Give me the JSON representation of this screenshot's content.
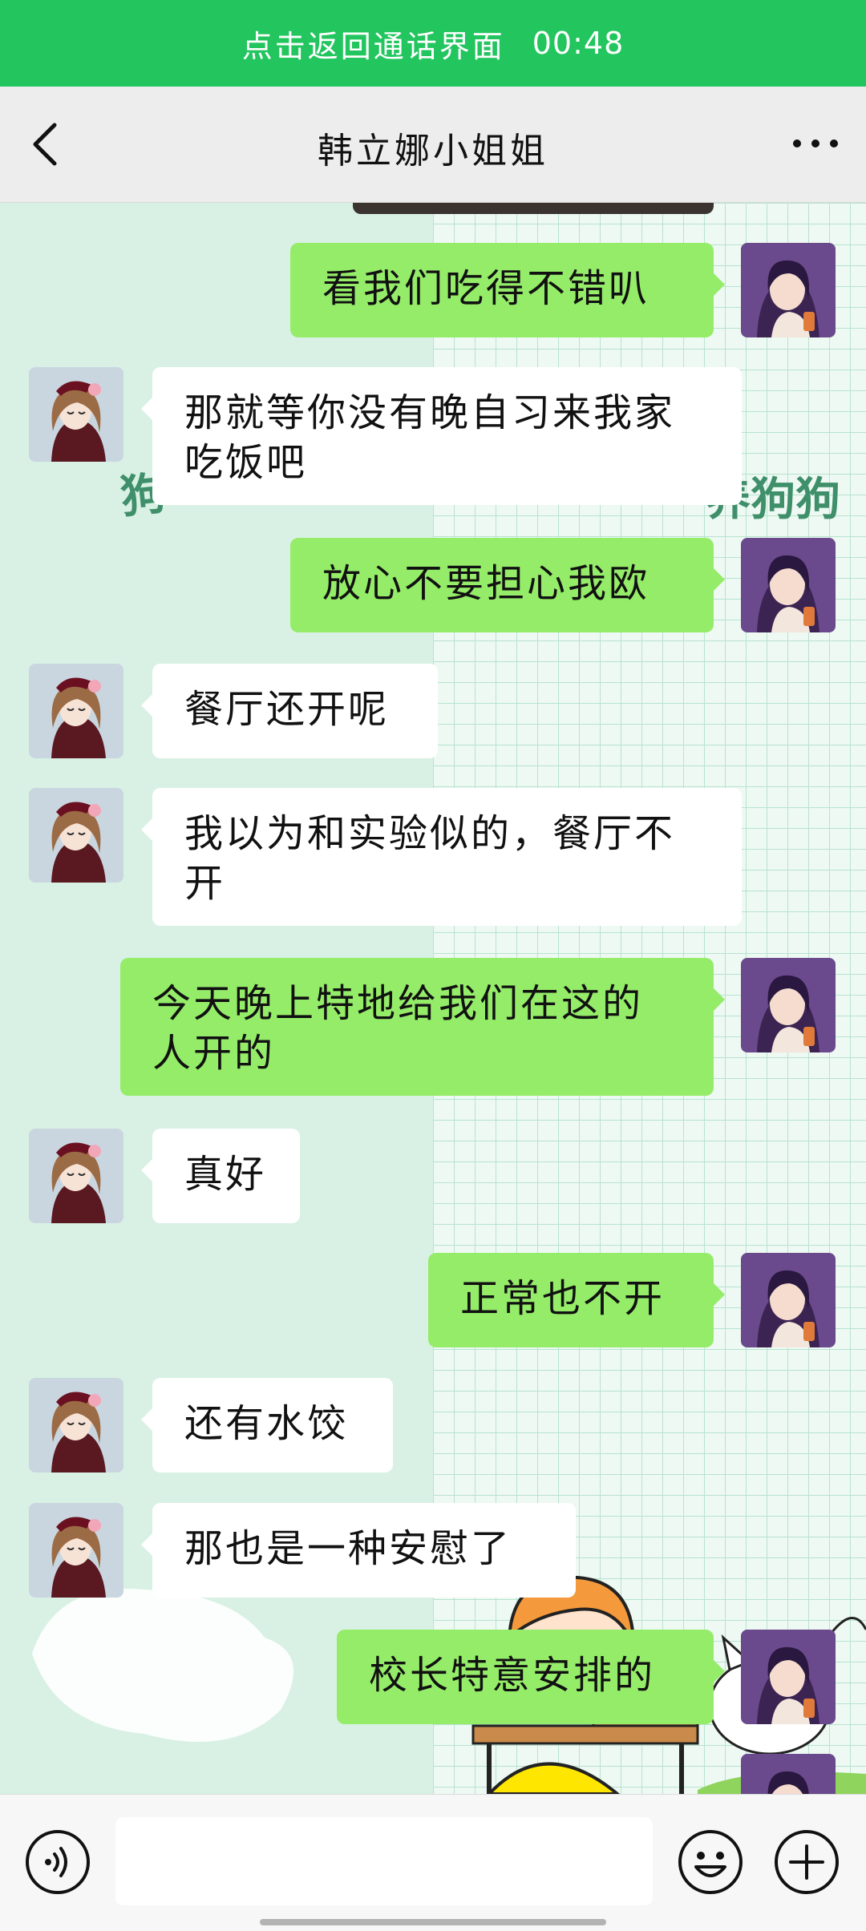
{
  "call_banner": {
    "text": "点击返回通话界面",
    "timer": "00:48",
    "color": "#22c55e"
  },
  "header": {
    "title": "韩立娜小姐姐",
    "back_icon": "chevron-left-icon",
    "more_icon": "ellipsis-icon"
  },
  "wallpaper": {
    "visible_text_left": "狗",
    "visible_text_right": "养狗狗"
  },
  "messages": [
    {
      "sender": "me",
      "text": "看我们吃得不错叭"
    },
    {
      "sender": "contact",
      "text": "那就等你没有晚自习来我家吃饭吧"
    },
    {
      "sender": "me",
      "text": "放心不要担心我欧"
    },
    {
      "sender": "contact",
      "text": "餐厅还开呢"
    },
    {
      "sender": "contact",
      "text": "我以为和实验似的，餐厅不开"
    },
    {
      "sender": "me",
      "text": "今天晚上特地给我们在这的人开的"
    },
    {
      "sender": "contact",
      "text": "真好"
    },
    {
      "sender": "me",
      "text": "正常也不开"
    },
    {
      "sender": "contact",
      "text": "还有水饺"
    },
    {
      "sender": "contact",
      "text": "那也是一种安慰了"
    },
    {
      "sender": "me",
      "text": "校长特意安排的"
    }
  ],
  "input_bar": {
    "voice_icon": "voice-icon",
    "input_value": "",
    "emoji_icon": "emoji-icon",
    "plus_icon": "plus-icon"
  },
  "colors": {
    "my_bubble": "#95ec69",
    "their_bubble": "#ffffff",
    "header_bg": "#ededed"
  }
}
